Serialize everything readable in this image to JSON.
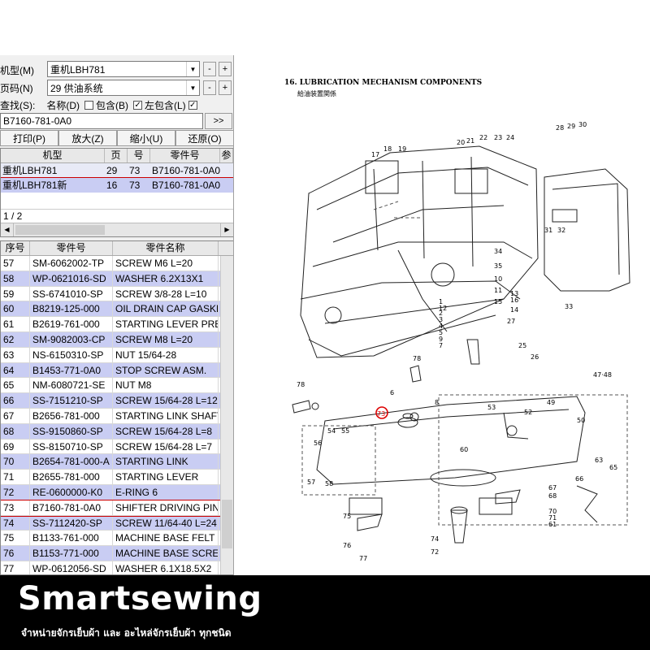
{
  "controls": {
    "model_label": "机型(M)",
    "model_value": "重机LBH781",
    "page_label": "页码(N)",
    "page_value": "29 供油系统",
    "search_label": "查找(S):",
    "name_option": "名称(D)",
    "include_b": "包含(B)",
    "left_include": "左包含(L)",
    "search_value": "B7160-781-0A0",
    "go_button": ">>",
    "minus": "-",
    "plus": "+"
  },
  "buttons": {
    "print": "打印(P)",
    "zoom_in": "放大(Z)",
    "zoom_out": "缩小(U)",
    "restore": "还原(O)"
  },
  "results": {
    "headers": [
      "机型",
      "页",
      "号",
      "零件号",
      "参"
    ],
    "rows": [
      [
        "重机LBH781",
        "29",
        "73",
        "B7160-781-0A0"
      ],
      [
        "重机LBH781新",
        "16",
        "73",
        "B7160-781-0A0"
      ]
    ],
    "pager": "1 / 2"
  },
  "parts": {
    "headers": [
      "序号",
      "零件号",
      "零件名称"
    ],
    "rows": [
      [
        "57",
        "SM-6062002-TP",
        "SCREW M6 L=20"
      ],
      [
        "58",
        "WP-0621016-SD",
        "WASHER 6.2X13X1"
      ],
      [
        "59",
        "SS-6741010-SP",
        "SCREW 3/8-28 L=10"
      ],
      [
        "60",
        "B8219-125-000",
        "OIL DRAIN CAP GASKE"
      ],
      [
        "61",
        "B2619-761-000",
        "STARTING LEVER PRES"
      ],
      [
        "62",
        "SM-9082003-CP",
        "SCREW M8 L=20"
      ],
      [
        "63",
        "NS-6150310-SP",
        "NUT 15/64-28"
      ],
      [
        "64",
        "B1453-771-0A0",
        "STOP SCREW ASM."
      ],
      [
        "65",
        "NM-6080721-SE",
        "NUT M8"
      ],
      [
        "66",
        "SS-7151210-SP",
        "SCREW 15/64-28 L=12"
      ],
      [
        "67",
        "B2656-781-000",
        "STARTING LINK SHAFT"
      ],
      [
        "68",
        "SS-9150860-SP",
        "SCREW 15/64-28 L=8"
      ],
      [
        "69",
        "SS-8150710-SP",
        "SCREW 15/64-28 L=7"
      ],
      [
        "70",
        "B2654-781-000-A",
        "STARTING LINK"
      ],
      [
        "71",
        "B2655-781-000",
        "STARTING LEVER"
      ],
      [
        "72",
        "RE-0600000-K0",
        "E-RING 6"
      ],
      [
        "73",
        "B7160-781-0A0",
        "SHIFTER DRIVING PIN"
      ],
      [
        "74",
        "SS-7112420-SP",
        "SCREW 11/64-40 L=24"
      ],
      [
        "75",
        "B1133-761-000",
        "MACHINE BASE FELT P"
      ],
      [
        "76",
        "B1153-771-000",
        "MACHINE BASE SCREW"
      ],
      [
        "77",
        "WP-0612056-SD",
        "WASHER 6.1X18.5X2"
      ]
    ]
  },
  "diagram": {
    "title": "16. LUBRICATION MECHANISM COMPONENTS",
    "subtitle": "給油装置関係",
    "labels": {
      "l1": "17",
      "l2": "18",
      "l3": "19",
      "l4": "20",
      "l5": "21",
      "l6": "22",
      "l7": "23",
      "l8": "24",
      "l9": "28",
      "l10": "29",
      "l11": "30",
      "l12": "31",
      "l13": "32",
      "l14": "33",
      "l15": "34",
      "l16": "35",
      "l17": "10",
      "l18": "11",
      "l19": "12",
      "l20": "14",
      "l21": "15",
      "l22": "16",
      "l23": "25",
      "l24": "26",
      "l25": "78",
      "l26": "73",
      "l27": "47·48",
      "l28": "53",
      "l29": "52",
      "l30": "49",
      "l31": "50",
      "l32": "60",
      "l33": "54",
      "l34": "55",
      "l35": "56",
      "l36": "57",
      "l37": "58",
      "l38": "63",
      "l39": "65",
      "l40": "66",
      "l41": "67",
      "l42": "68",
      "l43": "70",
      "l44": "71",
      "l45": "61",
      "l46": "75",
      "l47": "76",
      "l48": "77",
      "l49": "74",
      "l50": "72",
      "l51": "6",
      "l52": "8",
      "l53": "2",
      "l54": "3",
      "l55": "4",
      "l56": "5",
      "l57": "7",
      "l58": "9",
      "l59": "1",
      "l60": "27",
      "l61": "13"
    }
  },
  "banner": {
    "brand": "Smartsewing",
    "tagline": "จำหน่ายจักรเย็บผ้า และ อะไหล่จักรเย็บผ้า ทุกชนิด"
  }
}
